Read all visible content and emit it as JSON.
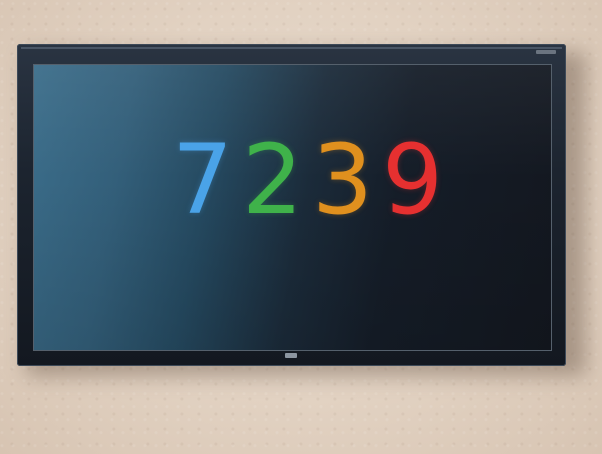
{
  "display": {
    "digits": [
      {
        "char": "7",
        "color": "#4aa3e8"
      },
      {
        "char": "2",
        "color": "#3fb24a"
      },
      {
        "char": "3",
        "color": "#e0901e"
      },
      {
        "char": "9",
        "color": "#e63030"
      }
    ]
  }
}
